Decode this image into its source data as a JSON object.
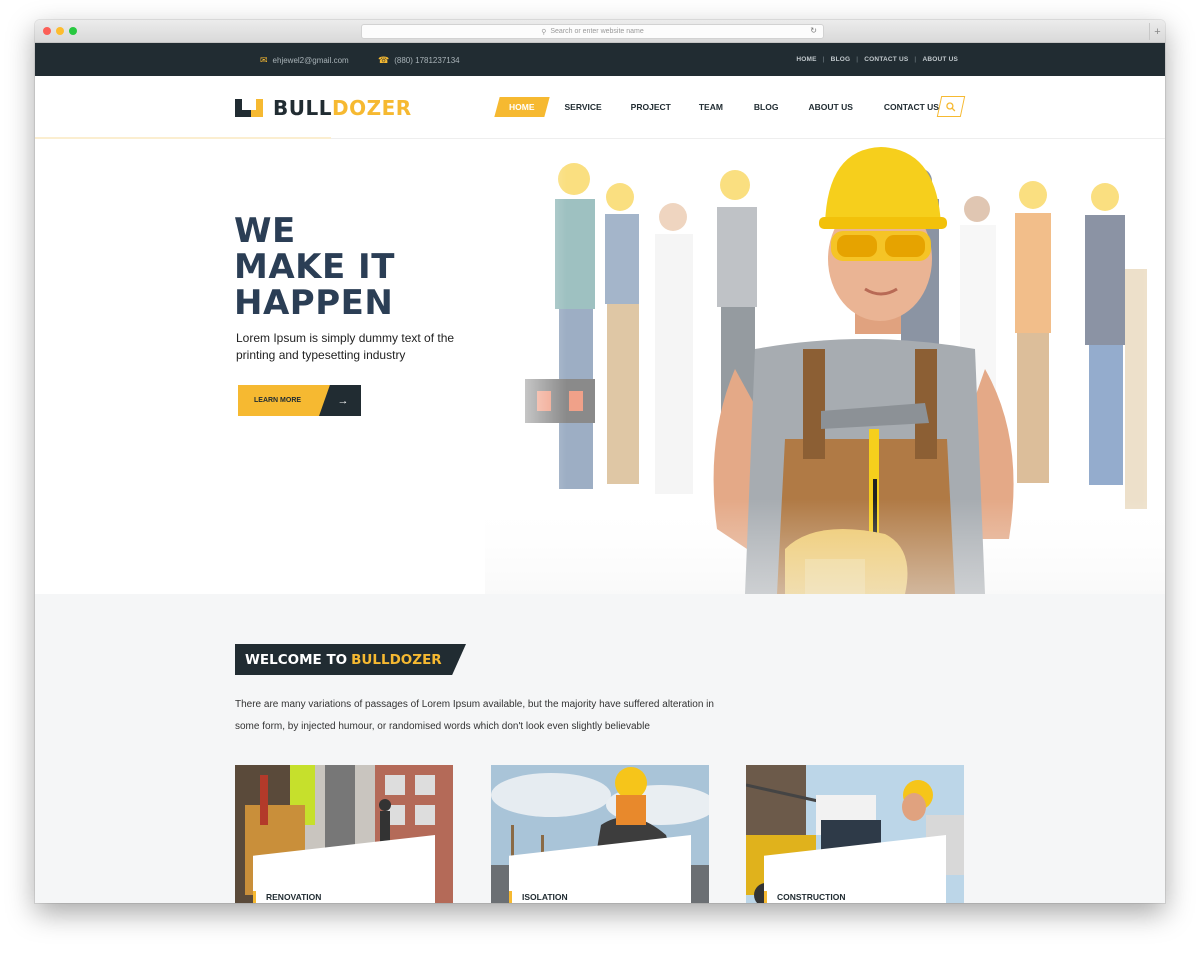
{
  "browser": {
    "address_placeholder": "Search or enter website name"
  },
  "topbar": {
    "email": "ehjewel2@gmail.com",
    "phone": "(880) 1781237134",
    "links": [
      "HOME",
      "BLOG",
      "CONTACT US",
      "ABOUT US"
    ]
  },
  "brand": {
    "part1": "BULL",
    "part2": "DOZER"
  },
  "nav": {
    "items": [
      "HOME",
      "SERVICE",
      "PROJECT",
      "TEAM",
      "BLOG",
      "ABOUT US",
      "CONTACT US"
    ],
    "active": "HOME"
  },
  "hero": {
    "title_lines": [
      "WE",
      "MAKE IT",
      "HAPPEN"
    ],
    "subtitle": "Lorem Ipsum is simply dummy text of the printing and typesetting industry",
    "button_label": "LEARN MORE"
  },
  "welcome": {
    "heading_prefix": "WELCOME TO",
    "heading_highlight": "BULLDOZER",
    "text": "There are many variations of passages of Lorem Ipsum available, but the majority have suffered alteration in some form, by injected humour, or randomised words which don't look even slightly believable"
  },
  "services": [
    {
      "title": "RENOVATION"
    },
    {
      "title": "ISOLATION"
    },
    {
      "title": "CONSTRUCTION"
    }
  ],
  "colors": {
    "accent": "#f6b931",
    "dark": "#212c32",
    "heading": "#2b3e55"
  }
}
